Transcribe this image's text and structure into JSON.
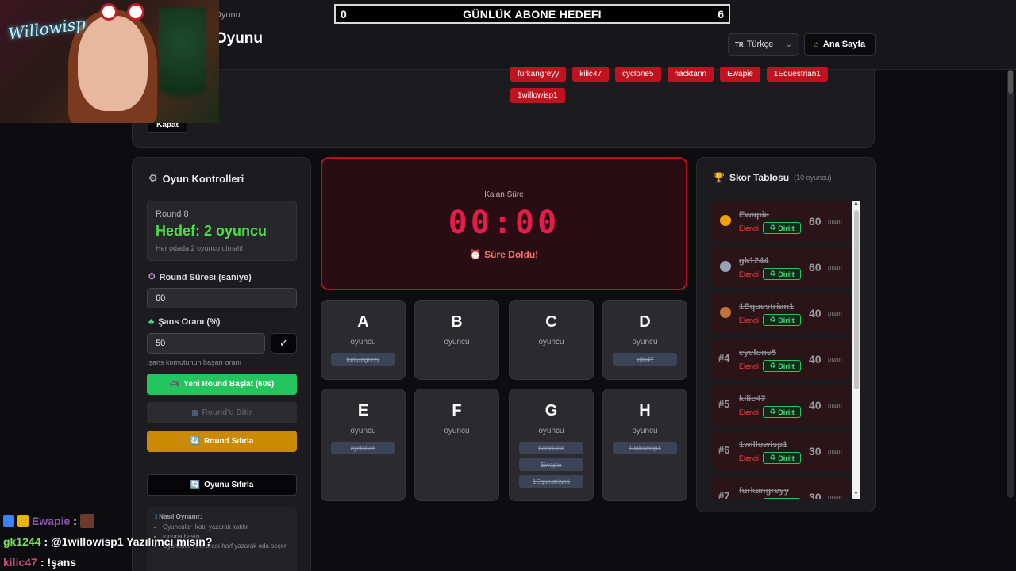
{
  "header": {
    "breadcrumb": "da Oyunu",
    "title": "a Oyunu",
    "language": {
      "flag": "TR",
      "label": "Türkçe"
    },
    "home_button": "Ana Sayfa"
  },
  "goal_bar": {
    "left_value": "0",
    "label": "GÜNLÜK ABONE HEDEFI",
    "right_value": "6"
  },
  "info_panel": {
    "tags": [
      "furkangreyy",
      "kilic47",
      "cyclone5",
      "hacktann",
      "Ewapie",
      "1Equestrian1",
      "1willowisp1"
    ],
    "close_label": "Kapat"
  },
  "webcam": {
    "neon_text": "Willowisp"
  },
  "controls": {
    "title": "Oyun Kontrolleri",
    "round_label": "Round 8",
    "target": "Hedef: 2 oyuncu",
    "target_hint": "Her odada 2 oyuncu olmalı!",
    "duration_label": "Round Süresi (saniye)",
    "duration_value": "60",
    "chance_label": "Şans Oranı (%)",
    "chance_value": "50",
    "chance_hint": "!şans komutunun başarı oranı",
    "start_button": "Yeni Round Başlat (60s)",
    "end_button": "Round'u Bitir",
    "reset_round_button": "Round Sıfırla",
    "reset_game_button": "Oyunu Sıfırla",
    "howto_title": "Nasıl Oynanır:",
    "howto_items": [
      "Oyuncular !katıl yazarak katılır",
      "tonuna basın",
      "Oyuncular A-H arası harf yazarak oda seçer"
    ]
  },
  "timer": {
    "label": "Kalan Süre",
    "value": "00:00",
    "status": "Süre Doldu!"
  },
  "rooms": [
    {
      "letter": "A",
      "sub": "oyuncu",
      "players": [
        "furkangreyy"
      ]
    },
    {
      "letter": "B",
      "sub": "oyuncu",
      "players": []
    },
    {
      "letter": "C",
      "sub": "oyuncu",
      "players": []
    },
    {
      "letter": "D",
      "sub": "oyuncu",
      "players": [
        "kilic47"
      ]
    },
    {
      "letter": "E",
      "sub": "oyuncu",
      "players": [
        "cyclone5"
      ]
    },
    {
      "letter": "F",
      "sub": "oyuncu",
      "players": []
    },
    {
      "letter": "G",
      "sub": "oyuncu",
      "players": [
        "hacktann",
        "Ewapie",
        "1Equestrian1"
      ]
    },
    {
      "letter": "H",
      "sub": "oyuncu",
      "players": [
        "1willowisp1"
      ]
    }
  ],
  "scoreboard": {
    "title": "Skor Tablosu",
    "count": "(10 oyuncu)",
    "status_label": "Elendi",
    "revive_label": "Dirilt",
    "points_unit": "puan",
    "entries": [
      {
        "rank": "",
        "medal": "gold",
        "name": "Ewapie",
        "points": "60"
      },
      {
        "rank": "",
        "medal": "silver",
        "name": "gk1244",
        "points": "60"
      },
      {
        "rank": "",
        "medal": "bronze",
        "name": "1Equestrian1",
        "points": "40"
      },
      {
        "rank": "#4",
        "medal": "",
        "name": "cyclone5",
        "points": "40"
      },
      {
        "rank": "#5",
        "medal": "",
        "name": "kilic47",
        "points": "40"
      },
      {
        "rank": "#6",
        "medal": "",
        "name": "1willowisp1",
        "points": "30"
      },
      {
        "rank": "#7",
        "medal": "",
        "name": "furkangreyy",
        "points": "30"
      }
    ]
  },
  "chat": [
    {
      "user": "Ewapie",
      "sep": ":",
      "message": ""
    },
    {
      "user": "gk1244",
      "sep": ":",
      "message": "@1willowisp1 Yazılımcı mısın?"
    },
    {
      "user": "kilic47",
      "sep": ":",
      "message": "!şans"
    }
  ],
  "colors": {
    "accent_red": "#c1121f",
    "timer_red": "#e11d48",
    "green": "#22c55e",
    "amber": "#ca8a04",
    "bg": "#0d0d0f"
  }
}
